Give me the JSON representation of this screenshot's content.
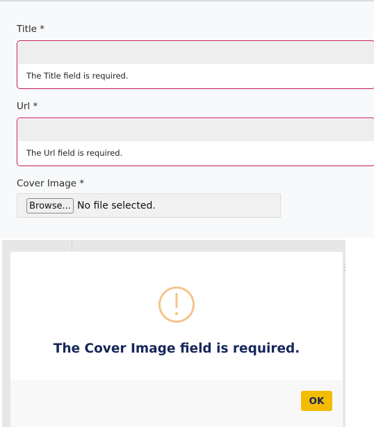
{
  "form": {
    "title_label": "Title *",
    "title_error": "The Title field is required.",
    "url_label": "Url *",
    "url_error": "The Url field is required.",
    "cover_label": "Cover Image *",
    "browse_label": "Browse...",
    "file_status": "No file selected."
  },
  "dialog": {
    "icon": "warning-icon",
    "message": "The Cover Image field is required.",
    "ok_label": "OK"
  },
  "colors": {
    "error_border": "#c2185b",
    "warning_icon": "#f5c388",
    "ok_button": "#f4bc00",
    "message_text": "#16265a"
  }
}
